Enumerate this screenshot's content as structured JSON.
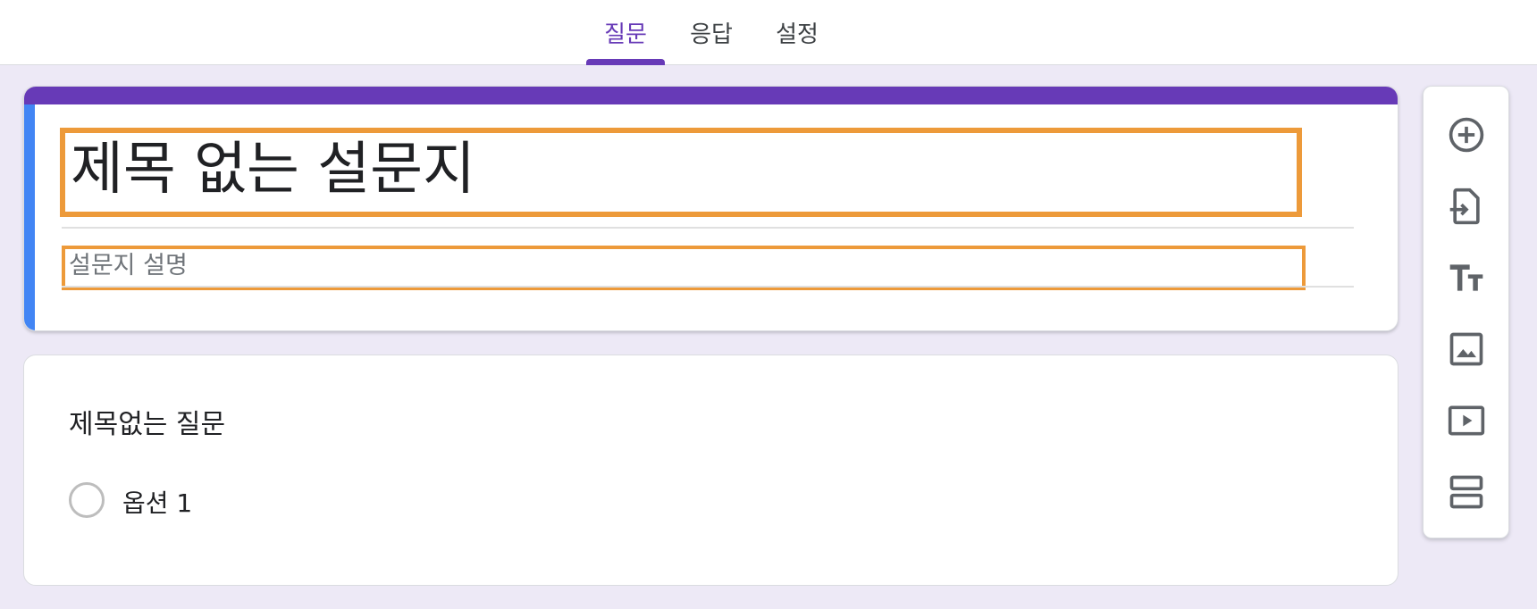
{
  "tabs": [
    {
      "label": "질문",
      "active": true
    },
    {
      "label": "응답",
      "active": false
    },
    {
      "label": "설정",
      "active": false
    }
  ],
  "form": {
    "title": "제목 없는 설문지",
    "description_placeholder": "설문지 설명"
  },
  "question": {
    "title": "제목없는 질문",
    "options": [
      "옵션 1"
    ]
  },
  "toolbar": {
    "tools": [
      "add-question-icon",
      "import-questions-icon",
      "add-title-icon",
      "add-image-icon",
      "add-video-icon",
      "add-section-icon"
    ]
  },
  "colors": {
    "accent": "#673ab7",
    "side_accent": "#4285f4",
    "highlight": "#ed9a3a",
    "background": "#ede9f6"
  }
}
